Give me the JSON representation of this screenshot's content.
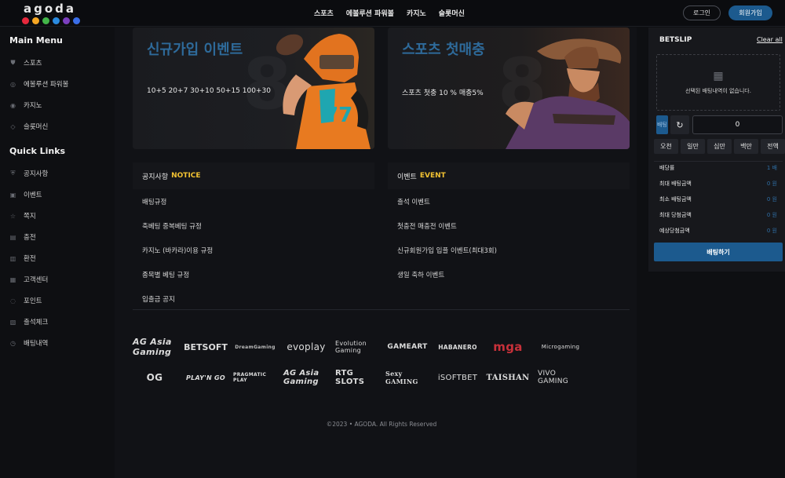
{
  "header": {
    "logo_text": "agoda",
    "logo_dot_colors": [
      "#e6283c",
      "#f5a623",
      "#43b649",
      "#2a8adf",
      "#7b3fbf",
      "#3a6ee8"
    ],
    "nav": [
      "스포츠",
      "에볼루션 파워볼",
      "카지노",
      "슬롯머신"
    ],
    "login_label": "로그인",
    "join_label": "회원가입"
  },
  "sidebar": {
    "main_menu_title": "Main Menu",
    "main_menu": [
      {
        "label": "스포츠",
        "icon": "shield-icon"
      },
      {
        "label": "에볼루션 파워볼",
        "icon": "ball-icon"
      },
      {
        "label": "카지노",
        "icon": "chip-icon"
      },
      {
        "label": "슬롯머신",
        "icon": "diamond-icon"
      }
    ],
    "quick_links_title": "Quick Links",
    "quick_links": [
      {
        "label": "공지사항",
        "icon": "notice-icon"
      },
      {
        "label": "이벤트",
        "icon": "event-icon"
      },
      {
        "label": "쪽지",
        "icon": "star-icon"
      },
      {
        "label": "충전",
        "icon": "deposit-icon"
      },
      {
        "label": "환전",
        "icon": "withdraw-icon"
      },
      {
        "label": "고객센터",
        "icon": "chat-icon"
      },
      {
        "label": "포인트",
        "icon": "points-icon"
      },
      {
        "label": "출석체크",
        "icon": "calendar-icon"
      },
      {
        "label": "배팅내역",
        "icon": "history-icon"
      }
    ]
  },
  "banners": [
    {
      "title": "신규가입 이벤트",
      "subtitle": "10+5 20+7 30+10 50+15 100+30"
    },
    {
      "title": "스포츠 첫매충",
      "subtitle": "스포츠 첫충 10 % 매충5%"
    }
  ],
  "notice": {
    "head": "공지사항",
    "head_hl": "NOTICE",
    "items": [
      "배팅규정",
      "축베팅 중복베팅 규정",
      "카지노 (바카라)이용 규정",
      "종목별 베팅 규정",
      "입출금 공지"
    ]
  },
  "event": {
    "head": "이벤트",
    "head_hl": "EVENT",
    "items": [
      "출석 이벤트",
      "첫충전 매충전 이벤트",
      "신규회원가입 입플 이벤트(최대3회)",
      "생일 축하 이벤트"
    ]
  },
  "providers": {
    "row1": [
      "AG Asia Gaming",
      "BETSOFT",
      "DreamGaming",
      "evoplay",
      "Evolution Gaming",
      "GAMEART",
      "HABANERO",
      "mga",
      "Microgaming"
    ],
    "row2": [
      "OG",
      "PLAY'N GO",
      "PRAGMATIC PLAY",
      "AG Asia Gaming",
      "RTG SLOTS",
      "Sexy GAMING",
      "iSOFTBET",
      "TAISHAN",
      "VIVO GAMING"
    ]
  },
  "footer": {
    "copyright": "©2023 • AGODA. All Rights Reserved"
  },
  "betslip": {
    "title": "BETSLIP",
    "clear": "Clear all",
    "empty_msg": "선택된 배팅내역이 없습니다.",
    "tab_label": "배팅",
    "amount": "0",
    "chips": [
      "오천",
      "일만",
      "십만",
      "백만",
      "전액"
    ],
    "rows": [
      {
        "label": "배당률",
        "value": "1 배"
      },
      {
        "label": "최대 배팅금액",
        "value": "0 원"
      },
      {
        "label": "최소 배팅금액",
        "value": "0 원"
      },
      {
        "label": "최대 당첨금액",
        "value": "0 원"
      },
      {
        "label": "예상당첨금액",
        "value": "0 원"
      }
    ],
    "bet_button": "배팅하기"
  }
}
